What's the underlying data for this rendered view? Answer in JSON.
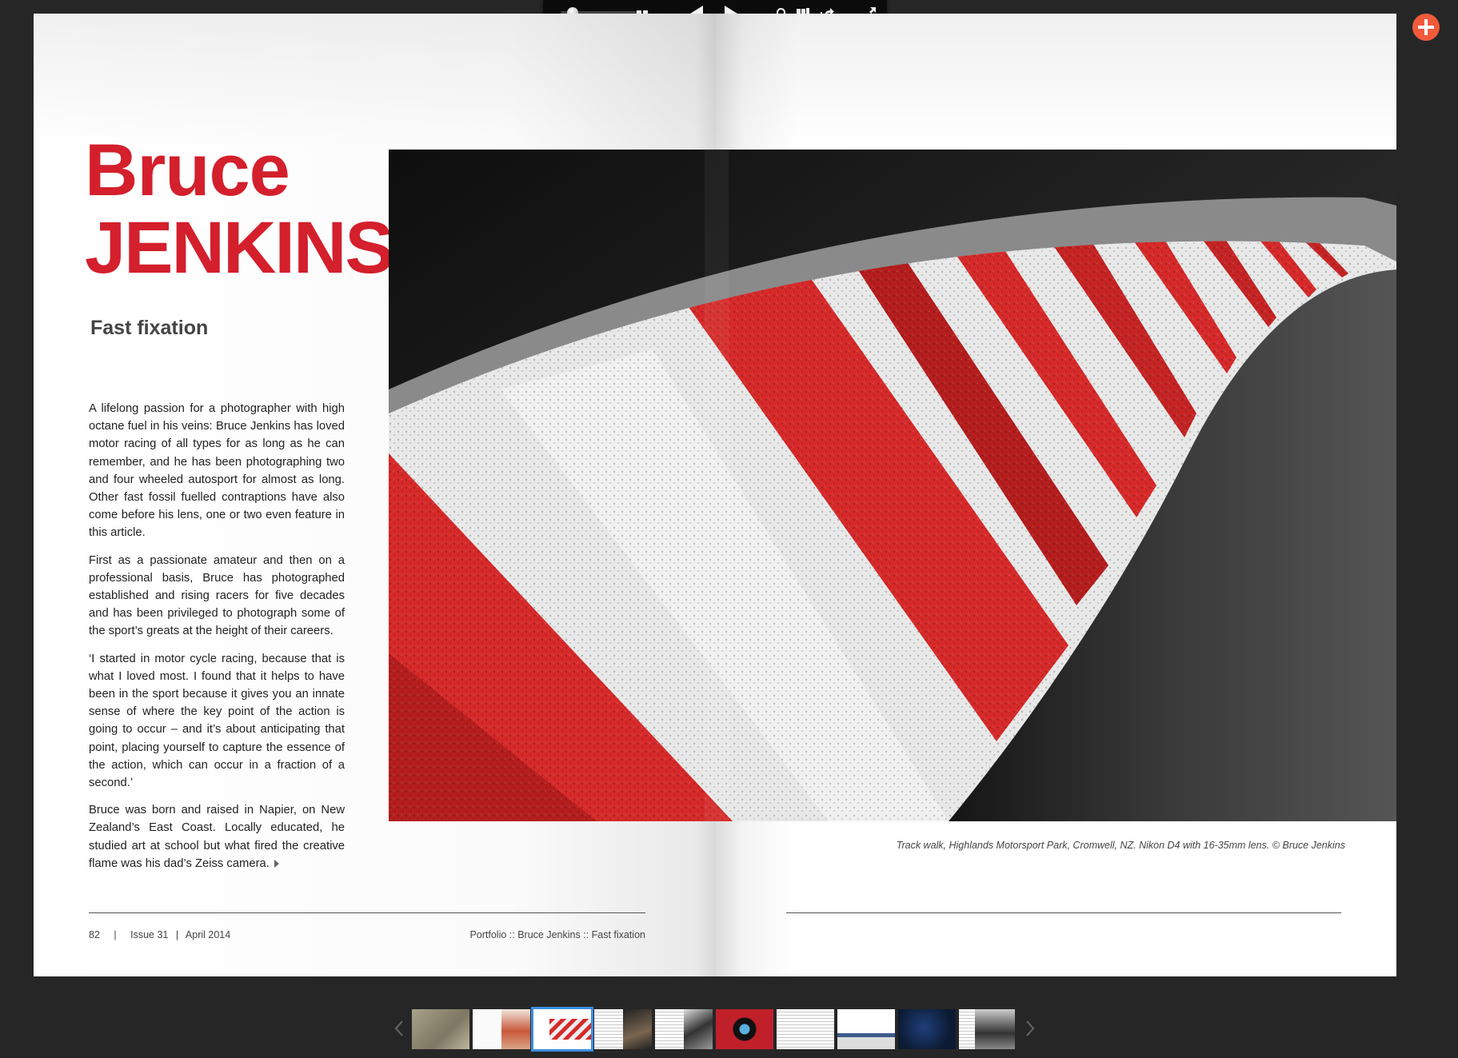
{
  "toolbar": {
    "items": [
      "zoom-slider",
      "two-page-view-icon",
      "previous-page-icon",
      "next-page-icon",
      "search-icon",
      "library-icon",
      "share-icon",
      "fullscreen-icon"
    ]
  },
  "add_button": {
    "icon": "plus-icon",
    "color": "#f15a3a"
  },
  "article": {
    "title_first": "Bruce",
    "title_last": "JENKINS",
    "subtitle": "Fast fixation",
    "paragraphs": [
      "A lifelong passion for a photographer with high octane fuel in his veins: Bruce Jenkins has loved motor racing of all types for as long as he can remember, and he has been photographing two and four wheeled autosport for almost as long. Other fast fossil fuelled contraptions have also come before his lens, one or two even feature in this article.",
      "First as a passionate amateur and then on a professional basis, Bruce has photographed established and rising racers for five decades and has been privileged to photograph some of the sport’s greats at the height of their careers.",
      "‘I started in motor cycle racing, because that is what I loved most. I found that it helps to have been in the sport because it gives you an innate sense of where the key point of the action is going to occur – and it’s about anticipating that point, placing yourself to capture the essence of the action, which can occur in a fraction of a second.’",
      "Bruce was born and raised in Napier, on New Zealand’s East Coast. Locally educated, he studied art at school but what fired the creative flame was his dad’s Zeiss camera."
    ],
    "caption": "Track walk, Highlands Motorsport Park, Cromwell, NZ. Nikon D4 with 16-35mm lens. © Bruce Jenkins",
    "accent_color": "#d41f2c"
  },
  "footer": {
    "page_number": "82",
    "separator": "|",
    "issue": "Issue 31",
    "separator2": "|",
    "date": "April 2014",
    "section": "Portfolio :: Bruce Jenkins :: Fast fixation"
  },
  "thumbnails": {
    "count": 10,
    "selected_index": 2
  }
}
